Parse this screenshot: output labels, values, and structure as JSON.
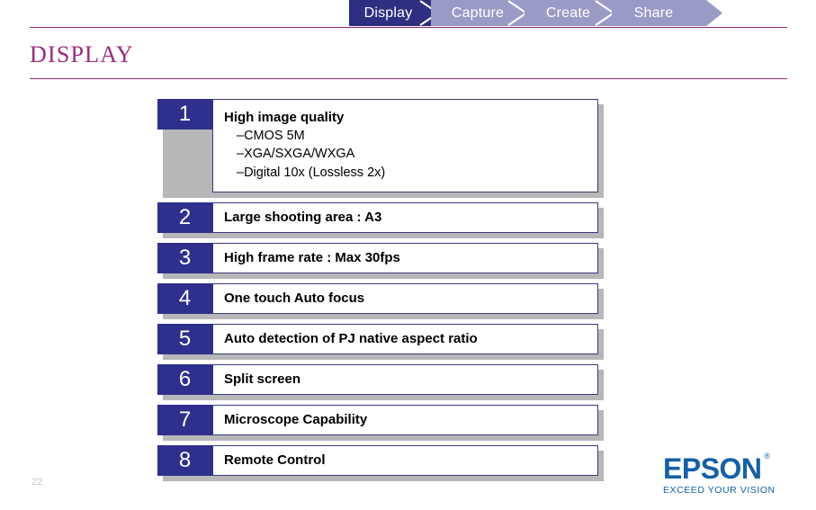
{
  "breadcrumb": {
    "items": [
      {
        "label": "Display",
        "active": true
      },
      {
        "label": "Capture",
        "active": false
      },
      {
        "label": "Create",
        "active": false
      },
      {
        "label": "Share",
        "active": false
      }
    ],
    "active_color": "#2f2f82",
    "inactive_color": "#9a9ac6",
    "text_color": "#ffffff"
  },
  "title": {
    "text": "DISPLAY",
    "color": "#9e2a7c"
  },
  "rule_color": "#8e2a73",
  "features": [
    {
      "number": "1",
      "title": "High image quality",
      "subitems": [
        "–CMOS 5M",
        "–XGA/SXGA/WXGA",
        "–Digital 10x (Lossless 2x)"
      ]
    },
    {
      "number": "2",
      "title": "Large shooting area : A3",
      "subitems": []
    },
    {
      "number": "3",
      "title": "High frame rate : Max 30fps",
      "subitems": []
    },
    {
      "number": "4",
      "title": "One touch Auto focus",
      "subitems": []
    },
    {
      "number": "5",
      "title": "Auto detection of PJ native aspect ratio",
      "subitems": []
    },
    {
      "number": "6",
      "title": "Split screen",
      "subitems": []
    },
    {
      "number": "7",
      "title": "Microscope Capability",
      "subitems": []
    },
    {
      "number": "8",
      "title": "Remote Control",
      "subitems": []
    }
  ],
  "badge_color": "#2f2f8e",
  "panel_border_color": "#3a3a78",
  "shadow_color": "#b7b7b7",
  "page_number": "22",
  "logo": {
    "wordmark": "EPSON",
    "registered": "®",
    "tagline": "EXCEED YOUR VISION",
    "color": "#1560a8"
  }
}
